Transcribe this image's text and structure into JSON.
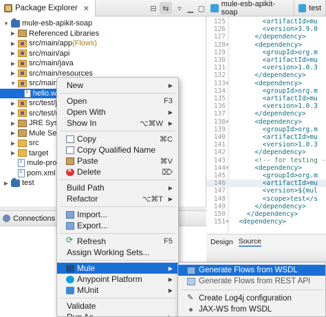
{
  "explorer": {
    "title": "Package Explorer",
    "close": "✕",
    "tree": [
      {
        "label": "mule-esb-apikit-soap",
        "level": 0,
        "twist": "open",
        "icon": "project",
        "name": "tree-item-project"
      },
      {
        "label": "Referenced Libraries",
        "level": 1,
        "twist": "closed",
        "icon": "lib",
        "name": "tree-item-referenced-libraries"
      },
      {
        "label": "src/main/app",
        "suffix": " (Flows)",
        "level": 1,
        "twist": "closed",
        "icon": "srcfolder",
        "name": "tree-item-src-main-app"
      },
      {
        "label": "src/main/api",
        "level": 1,
        "twist": "closed",
        "icon": "srcfolder",
        "name": "tree-item-src-main-api"
      },
      {
        "label": "src/main/java",
        "level": 1,
        "twist": "closed",
        "icon": "srcfolder",
        "name": "tree-item-src-main-java"
      },
      {
        "label": "src/main/resources",
        "level": 1,
        "twist": "closed",
        "icon": "srcfolder",
        "name": "tree-item-src-main-resources"
      },
      {
        "label": "src/main/wsdl",
        "level": 1,
        "twist": "open",
        "icon": "srcfolder",
        "name": "tree-item-src-main-wsdl"
      },
      {
        "label": "hello.w",
        "level": 2,
        "twist": "",
        "icon": "xml",
        "selected": true,
        "name": "tree-item-hello-wsdl"
      },
      {
        "label": "src/test/ja",
        "level": 1,
        "twist": "closed",
        "icon": "srcfolder",
        "name": "tree-item-src-test-java"
      },
      {
        "label": "src/test/re",
        "level": 1,
        "twist": "closed",
        "icon": "srcfolder",
        "name": "tree-item-src-test-resources"
      },
      {
        "label": "JRE Syste",
        "level": 1,
        "twist": "closed",
        "icon": "lib",
        "name": "tree-item-jre-system"
      },
      {
        "label": "Mule Serv",
        "level": 1,
        "twist": "closed",
        "icon": "lib",
        "name": "tree-item-mule-server"
      },
      {
        "label": "src",
        "level": 1,
        "twist": "closed",
        "icon": "folder",
        "name": "tree-item-src"
      },
      {
        "label": "target",
        "level": 1,
        "twist": "closed",
        "icon": "folder",
        "name": "tree-item-target"
      },
      {
        "label": "mule-proj",
        "level": 1,
        "twist": "",
        "icon": "xml",
        "name": "tree-item-mule-project"
      },
      {
        "label": "pom.xml",
        "level": 1,
        "twist": "",
        "icon": "xml",
        "name": "tree-item-pom-xml"
      },
      {
        "label": "test",
        "level": 0,
        "twist": "closed",
        "icon": "project",
        "name": "tree-item-test"
      }
    ]
  },
  "editor": {
    "tabs": [
      {
        "label": "mule-esb-apikit-soap",
        "name": "editor-tab-mule-esb-apikit-soap"
      },
      {
        "label": "test",
        "name": "editor-tab-test"
      }
    ],
    "lines": [
      {
        "n": "125",
        "fold": "",
        "text": "        <artifactId>mu"
      },
      {
        "n": "126",
        "fold": "",
        "text": "        <version>3.9.0"
      },
      {
        "n": "127",
        "fold": "",
        "text": "      </dependency>"
      },
      {
        "n": "128",
        "fold": "⊖",
        "text": "      <dependency>"
      },
      {
        "n": "129",
        "fold": "",
        "text": "        <groupId>org.m"
      },
      {
        "n": "130",
        "fold": "",
        "text": "        <artifactId>mu"
      },
      {
        "n": "131",
        "fold": "",
        "text": "        <version>1.0.3"
      },
      {
        "n": "132",
        "fold": "",
        "text": "      </dependency>"
      },
      {
        "n": "133",
        "fold": "⊖",
        "text": "      <dependency>"
      },
      {
        "n": "134",
        "fold": "",
        "text": "        <groupId>org.m"
      },
      {
        "n": "135",
        "fold": "",
        "text": "        <artifactId>mu"
      },
      {
        "n": "136",
        "fold": "",
        "text": "        <version>1.0.3"
      },
      {
        "n": "137",
        "fold": "",
        "text": "      </dependency>"
      },
      {
        "n": "138",
        "fold": "⊖",
        "text": "      <dependency>"
      },
      {
        "n": "139",
        "fold": "",
        "text": "        <groupId>org.m"
      },
      {
        "n": "140",
        "fold": "",
        "text": "        <artifactId>mu"
      },
      {
        "n": "141",
        "fold": "",
        "text": "        <version>1.0.3"
      },
      {
        "n": "142",
        "fold": "",
        "text": "      </dependency>"
      },
      {
        "n": "143",
        "fold": "",
        "text": "      <!-- for testing -"
      },
      {
        "n": "144",
        "fold": "⊖",
        "text": "      <dependency>"
      },
      {
        "n": "145",
        "fold": "",
        "text": "        <groupId>org.m"
      },
      {
        "n": "146",
        "fold": "",
        "text": "        <artifactId>mu",
        "highlight": true
      },
      {
        "n": "147",
        "fold": "",
        "text": "        <version>${mul"
      },
      {
        "n": "148",
        "fold": "",
        "text": "        <scope>test</s"
      },
      {
        "n": "149",
        "fold": "",
        "text": "      </dependency>"
      },
      {
        "n": "150",
        "fold": "",
        "text": "    </dependency>"
      },
      {
        "n": "151",
        "fold": "⊖",
        "text": "  <dependency>"
      }
    ],
    "source_tabs": {
      "design": "Design",
      "source": "Source"
    }
  },
  "connections": {
    "title": "Connections Exp"
  },
  "context_menu": {
    "items": [
      {
        "label": "New",
        "arrow": "▶",
        "name": "menu-new"
      },
      {
        "sep": true
      },
      {
        "label": "Open",
        "shortcut": "F3",
        "name": "menu-open"
      },
      {
        "label": "Open With",
        "arrow": "▶",
        "name": "menu-open-with"
      },
      {
        "label": "Show In",
        "shortcut": "⌥⌘W",
        "arrow": "▶",
        "name": "menu-show-in"
      },
      {
        "sep": true
      },
      {
        "label": "Copy",
        "shortcut": "⌘C",
        "icon": "copy",
        "name": "menu-copy"
      },
      {
        "label": "Copy Qualified Name",
        "icon": "copy",
        "name": "menu-copy-qualified-name"
      },
      {
        "label": "Paste",
        "shortcut": "⌘V",
        "icon": "paste",
        "name": "menu-paste"
      },
      {
        "label": "Delete",
        "shortcut": "⌦",
        "icon": "delete",
        "name": "menu-delete"
      },
      {
        "sep": true
      },
      {
        "label": "Build Path",
        "arrow": "▶",
        "name": "menu-build-path"
      },
      {
        "label": "Refactor",
        "shortcut": "⌥⌘T",
        "arrow": "▶",
        "name": "menu-refactor"
      },
      {
        "sep": true
      },
      {
        "label": "Import...",
        "icon": "import",
        "name": "menu-import"
      },
      {
        "label": "Export...",
        "icon": "import",
        "name": "menu-export"
      },
      {
        "sep": true
      },
      {
        "label": "Refresh",
        "shortcut": "F5",
        "icon": "refresh",
        "name": "menu-refresh"
      },
      {
        "label": "Assign Working Sets...",
        "name": "menu-assign-working-sets"
      },
      {
        "sep": true
      },
      {
        "label": "Mule",
        "arrow": "▶",
        "icon": "mule",
        "active": true,
        "name": "menu-mule"
      },
      {
        "label": "Anypoint Platform",
        "arrow": "▶",
        "icon": "anypoint",
        "name": "menu-anypoint-platform"
      },
      {
        "label": "MUnit",
        "arrow": "▶",
        "icon": "munit",
        "name": "menu-munit"
      },
      {
        "sep": true
      },
      {
        "label": "Validate",
        "name": "menu-validate"
      },
      {
        "label": "Run As",
        "arrow": "▶",
        "name": "menu-run-as"
      }
    ]
  },
  "submenu": {
    "items": [
      {
        "label": "Generate Flows from WSDL",
        "icon": "gen",
        "active": true,
        "name": "submenu-generate-flows-wsdl"
      },
      {
        "label": "Generate Flows from REST API",
        "icon": "gen2",
        "disabled": true,
        "name": "submenu-generate-flows-rest"
      },
      {
        "sep": true
      },
      {
        "label": "Create Log4j configuration",
        "icon": "log",
        "name": "submenu-create-log4j"
      },
      {
        "label": "JAX-WS from WSDL",
        "icon": "dot",
        "name": "submenu-jaxws-from-wsdl"
      }
    ]
  },
  "colors": {
    "selection": "#1a6fd6",
    "flows_suffix": "#b07a1f"
  }
}
